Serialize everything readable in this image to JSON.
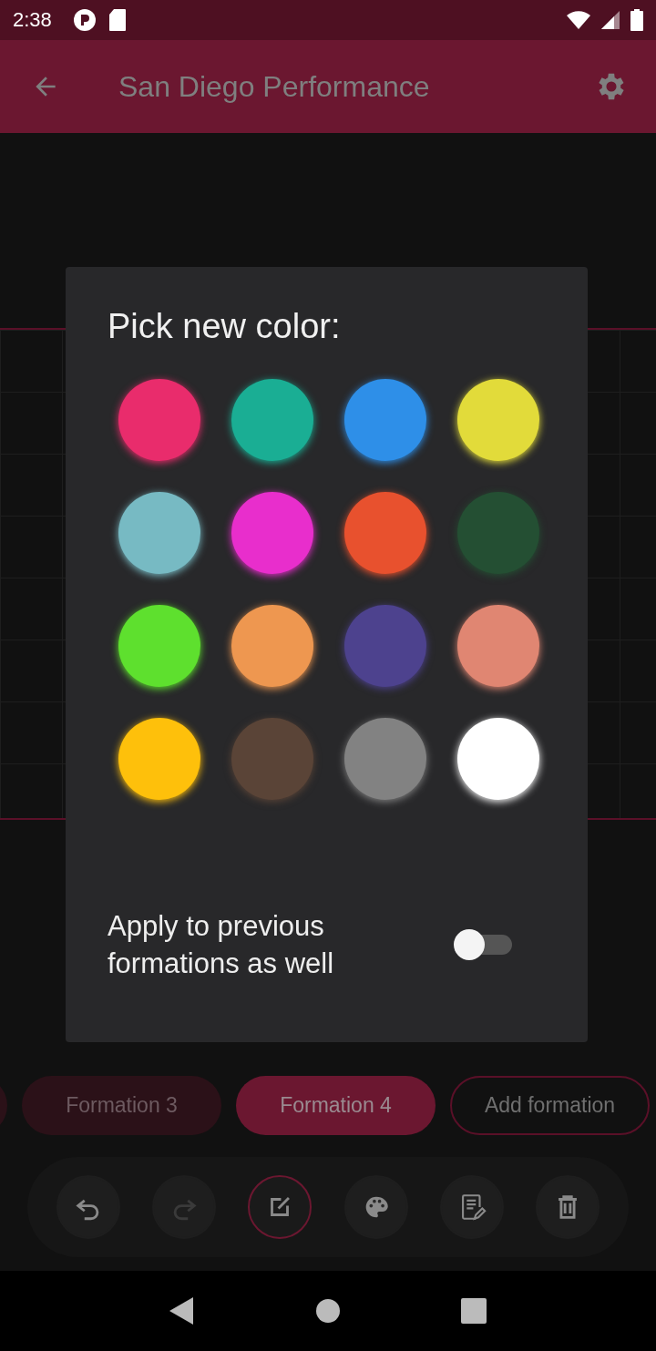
{
  "status_bar": {
    "time": "2:38"
  },
  "app_bar": {
    "title": "San Diego Performance"
  },
  "dialog": {
    "title": "Pick new color:",
    "swatches": [
      {
        "color": "#e92c6c"
      },
      {
        "color": "#1aae94"
      },
      {
        "color": "#2e8fe8"
      },
      {
        "color": "#e2db3a"
      },
      {
        "color": "#77bac3"
      },
      {
        "color": "#e82ecc"
      },
      {
        "color": "#e8512e"
      },
      {
        "color": "#244f33"
      },
      {
        "color": "#5ee02e"
      },
      {
        "color": "#ee9750"
      },
      {
        "color": "#4d428e"
      },
      {
        "color": "#e08672"
      },
      {
        "color": "#fec00b"
      },
      {
        "color": "#5a4437"
      },
      {
        "color": "#828282"
      },
      {
        "color": "#ffffff"
      }
    ],
    "toggle": {
      "label": "Apply to previous formations as well",
      "on": false
    }
  },
  "formations": [
    {
      "kind": "cut",
      "selected": false
    },
    {
      "kind": "chip",
      "label": "Formation 3",
      "selected": false
    },
    {
      "kind": "chip",
      "label": "Formation 4",
      "selected": true
    },
    {
      "kind": "add",
      "label": "Add formation",
      "selected": false
    }
  ],
  "tools": [
    {
      "kind": "undo",
      "selected": false,
      "disabled": false
    },
    {
      "kind": "redo",
      "selected": false,
      "disabled": true
    },
    {
      "kind": "edit",
      "selected": true,
      "disabled": false
    },
    {
      "kind": "palette",
      "selected": false,
      "disabled": false
    },
    {
      "kind": "notes",
      "selected": false,
      "disabled": false
    },
    {
      "kind": "delete",
      "selected": false,
      "disabled": false
    }
  ]
}
